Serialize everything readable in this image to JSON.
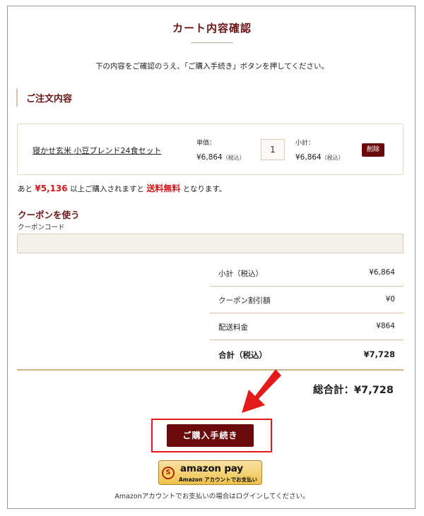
{
  "page": {
    "title": "カート内容確認",
    "lead": "下の内容をご確認のうえ、「ご購入手続き」ボタンを押してください。"
  },
  "order_section": {
    "title": "ご注文内容"
  },
  "item": {
    "name": "寝かせ玄米 小豆ブレンド24食セット",
    "unit_label": "単価：",
    "unit_price": "¥6,864",
    "tax_note": "（税込）",
    "quantity": "1",
    "subtotal_label": "小計：",
    "subtotal_price": "¥6,864",
    "subtotal_tax_note": "（税込）",
    "delete_label": "削除"
  },
  "shipping_notice": {
    "prefix": "あと",
    "amount": "¥5,136",
    "middle": "以上ご購入されますと",
    "highlight": "送料無料",
    "suffix": "となります。"
  },
  "coupon": {
    "title": "クーポンを使う",
    "label": "クーポンコード",
    "value": "",
    "placeholder": ""
  },
  "summary": {
    "rows": [
      {
        "label": "小計（税込）",
        "value": "¥6,864"
      },
      {
        "label": "クーポン割引額",
        "value": "¥0"
      },
      {
        "label": "配送料金",
        "value": "¥864"
      },
      {
        "label": "合計（税込）",
        "value": "¥7,728"
      }
    ],
    "grand_total": "総合計：¥7,728"
  },
  "checkout_button": {
    "label": "ご購入手続き"
  },
  "amazon_pay": {
    "logo_text": "amazon pay",
    "sub_text": "Amazon アカウントでお支払い",
    "badge": "S",
    "note": "Amazonアカウントでお支払いの場合はログインしてください。"
  },
  "colors": {
    "brand": "#6b1414",
    "button": "#6b0a0a",
    "highlight_red": "#d11a1a",
    "annotation_red": "#e41b1b",
    "amazon_gold": "#f0c14b"
  }
}
